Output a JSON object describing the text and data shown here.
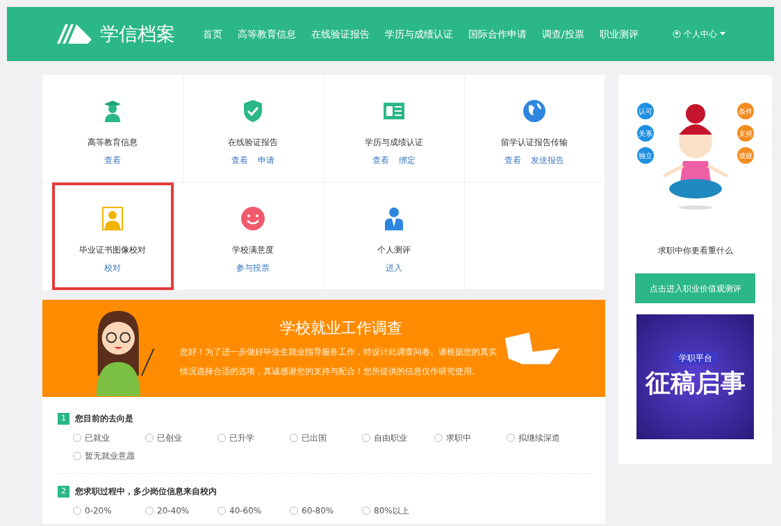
{
  "header": {
    "logo_text": "学信档案",
    "nav": [
      {
        "label": "首页",
        "selected": false
      },
      {
        "label": "高等教育信息",
        "selected": false
      },
      {
        "label": "在线验证报告",
        "selected": false
      },
      {
        "label": "学历与成绩认证",
        "selected": false
      },
      {
        "label": "国际合作申请",
        "selected": false
      },
      {
        "label": "调查/投票",
        "selected": false
      },
      {
        "label": "职业测评",
        "selected": false
      }
    ],
    "user_menu": "个人中心"
  },
  "services": [
    {
      "kind": "graduate",
      "title": "高等教育信息",
      "links": [
        "查看"
      ],
      "highlighted": false
    },
    {
      "kind": "shield",
      "title": "在线验证报告",
      "links": [
        "查看",
        "申请"
      ],
      "highlighted": false
    },
    {
      "kind": "document",
      "title": "学历与成绩认证",
      "links": [
        "查看",
        "绑定"
      ],
      "highlighted": false
    },
    {
      "kind": "globe",
      "title": "留学认证报告传输",
      "links": [
        "查看",
        "发送报告"
      ],
      "highlighted": false
    },
    {
      "kind": "portrait",
      "title": "毕业证书图像校对",
      "links": [
        "校对"
      ],
      "highlighted": true
    },
    {
      "kind": "smile",
      "title": "学校满意度",
      "links": [
        "参与投票"
      ],
      "highlighted": false
    },
    {
      "kind": "person",
      "title": "个人测评",
      "links": [
        "进入"
      ],
      "highlighted": false
    }
  ],
  "survey": {
    "title": "学校就业工作调查",
    "intro": "您好！为了进一步做好毕业生就业指导服务工作，特设计此调查问卷。请根据您的真实情况选择合适的选项，真诚感谢您的支持与配合！您所提供的信息仅作研究使用。",
    "questions": [
      {
        "number": "1",
        "text": "您目前的去向是",
        "options": [
          {
            "label": "已就业",
            "selected": false
          },
          {
            "label": "已创业",
            "selected": false
          },
          {
            "label": "已升学",
            "selected": false
          },
          {
            "label": "已出国",
            "selected": false
          },
          {
            "label": "自由职业",
            "selected": false
          },
          {
            "label": "求职中",
            "selected": false
          },
          {
            "label": "拟继续深造",
            "selected": false
          },
          {
            "label": "暂无就业意愿",
            "selected": false
          }
        ]
      },
      {
        "number": "2",
        "text": "您求职过程中，多少岗位信息来自校内",
        "options": [
          {
            "label": "0-20%",
            "selected": false
          },
          {
            "label": "20-40%",
            "selected": false
          },
          {
            "label": "40-60%",
            "selected": false
          },
          {
            "label": "60-80%",
            "selected": false
          },
          {
            "label": "80%以上",
            "selected": false
          }
        ]
      }
    ]
  },
  "sidebar": {
    "bubbles_left": [
      "认可",
      "关系",
      "独立"
    ],
    "bubbles_right": [
      "条件",
      "支持",
      "成就"
    ],
    "caption": "求职中你更看重什么",
    "button": "点击进入职业价值观测评",
    "poster": {
      "subtitle": "学职平台",
      "title": "征稿启事"
    }
  }
}
